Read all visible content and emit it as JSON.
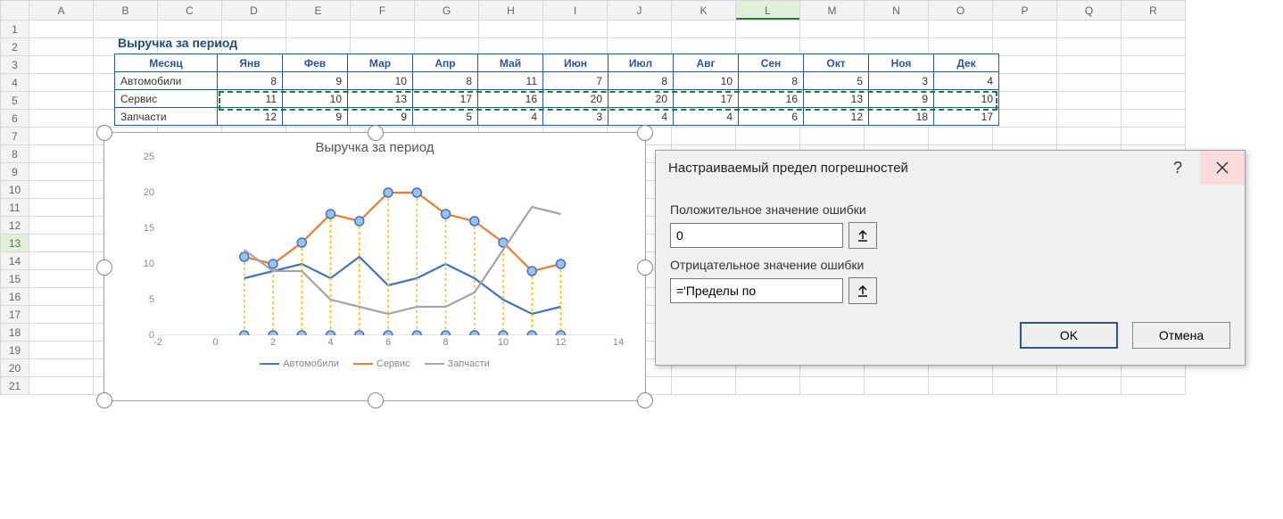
{
  "columns": [
    "A",
    "B",
    "C",
    "D",
    "E",
    "F",
    "G",
    "H",
    "I",
    "J",
    "K",
    "L",
    "M",
    "N",
    "O",
    "P",
    "Q",
    "R"
  ],
  "rowcount": 21,
  "selected_col": "L",
  "selected_row": 13,
  "title": "Выручка за период",
  "table": {
    "header_first": "Месяц",
    "months": [
      "Янв",
      "Фев",
      "Мар",
      "Апр",
      "Май",
      "Июн",
      "Июл",
      "Авг",
      "Сен",
      "Окт",
      "Ноя",
      "Дек"
    ],
    "rows": [
      {
        "label": "Автомобили",
        "vals": [
          8,
          9,
          10,
          8,
          11,
          7,
          8,
          10,
          8,
          5,
          3,
          4
        ]
      },
      {
        "label": "Сервис",
        "vals": [
          11,
          10,
          13,
          17,
          16,
          20,
          20,
          17,
          16,
          13,
          9,
          10
        ]
      },
      {
        "label": "Запчасти",
        "vals": [
          12,
          9,
          9,
          5,
          4,
          3,
          4,
          4,
          6,
          12,
          18,
          17
        ]
      }
    ]
  },
  "chart_data": {
    "type": "line",
    "title": "Выручка за период",
    "x": [
      1,
      2,
      3,
      4,
      5,
      6,
      7,
      8,
      9,
      10,
      11,
      12
    ],
    "xlim": [
      -2,
      14
    ],
    "ylim": [
      0,
      25
    ],
    "yticks": [
      0,
      5,
      10,
      15,
      20,
      25
    ],
    "xticks": [
      -2,
      0,
      2,
      4,
      6,
      8,
      10,
      12,
      14
    ],
    "series": [
      {
        "name": "Автомобили",
        "color": "#4472c4",
        "values": [
          8,
          9,
          10,
          8,
          11,
          7,
          8,
          10,
          8,
          5,
          3,
          4
        ]
      },
      {
        "name": "Сервис",
        "color": "#ed7d31",
        "values": [
          11,
          10,
          13,
          17,
          16,
          20,
          20,
          17,
          16,
          13,
          9,
          10
        ],
        "markers": true,
        "error_bars_to_zero": true
      },
      {
        "name": "Запчасти",
        "color": "#a5a5a5",
        "values": [
          12,
          9,
          9,
          5,
          4,
          3,
          4,
          4,
          6,
          12,
          18,
          17
        ]
      }
    ]
  },
  "dialog": {
    "title": "Настраиваемый предел погрешностей",
    "pos_label": "Положительное значение ошибки",
    "pos_value": "0",
    "neg_label": "Отрицательное значение ошибки",
    "neg_value": "='Пределы по",
    "ok": "OK",
    "cancel": "Отмена"
  }
}
